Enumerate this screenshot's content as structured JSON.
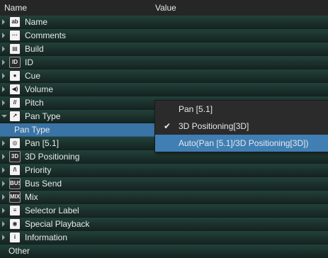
{
  "header": {
    "name_label": "Name",
    "value_label": "Value"
  },
  "rows": [
    {
      "label": "Name",
      "icon": "name-icon",
      "glyph": "ab"
    },
    {
      "label": "Comments",
      "icon": "comments-icon",
      "glyph": "···"
    },
    {
      "label": "Build",
      "icon": "build-icon",
      "glyph": "▤"
    },
    {
      "label": "ID",
      "icon": "id-icon",
      "glyph": "ID"
    },
    {
      "label": "Cue",
      "icon": "cue-icon",
      "glyph": "●"
    },
    {
      "label": "Volume",
      "icon": "volume-icon",
      "glyph": "◀)"
    },
    {
      "label": "Pitch",
      "icon": "pitch-icon",
      "glyph": "//"
    },
    {
      "label": "Pan Type",
      "icon": "pan-type-icon",
      "glyph": "↗",
      "expanded": true
    },
    {
      "label": "Pan Type",
      "sub": true
    },
    {
      "label": "Pan [5.1]",
      "icon": "pan-icon",
      "glyph": "◎"
    },
    {
      "label": "3D Positioning",
      "icon": "3d-positioning-icon",
      "glyph": "3D"
    },
    {
      "label": "Priority",
      "icon": "priority-icon",
      "glyph": "/\\"
    },
    {
      "label": "Bus Send",
      "icon": "bus-send-icon",
      "glyph": "BUS"
    },
    {
      "label": "Mix",
      "icon": "mix-icon",
      "glyph": "MIX"
    },
    {
      "label": "Selector Label",
      "icon": "selector-label-icon",
      "glyph": "≡"
    },
    {
      "label": "Special Playback",
      "icon": "special-playback-icon",
      "glyph": "◉"
    },
    {
      "label": "Information",
      "icon": "information-icon",
      "glyph": "i"
    },
    {
      "label": "Other",
      "plain": true
    }
  ],
  "dropdown": {
    "options": [
      {
        "label": "Pan [5.1]",
        "checked": false,
        "highlighted": false
      },
      {
        "label": "3D Positioning[3D]",
        "checked": true,
        "highlighted": false
      },
      {
        "label": "Auto(Pan [5.1]/3D Positioning[3D])",
        "checked": false,
        "highlighted": true
      }
    ],
    "check_glyph": "✔"
  }
}
